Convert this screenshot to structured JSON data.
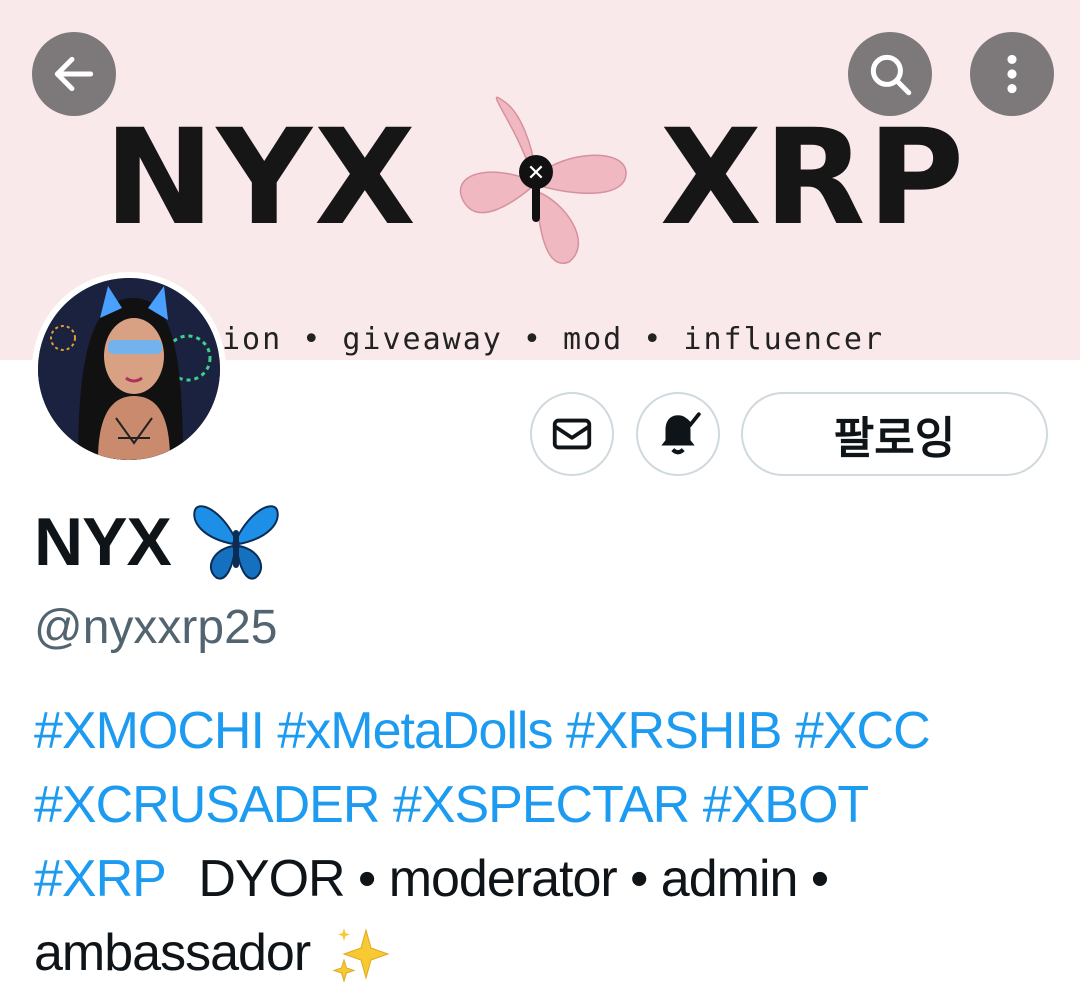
{
  "banner": {
    "word_left": "NYX",
    "word_right": "XRP",
    "tagline": "ion • giveaway • mod • influencer"
  },
  "nav": {
    "back_icon": "arrow-left-icon",
    "search_icon": "search-icon",
    "more_icon": "more-vertical-icon"
  },
  "actions": {
    "message_icon": "envelope-icon",
    "notify_icon": "bell-check-icon",
    "follow_label": "팔로잉"
  },
  "profile": {
    "display_name": "NYX",
    "name_emoji": "butterfly-icon",
    "handle": "@nyxxrp25"
  },
  "bio": {
    "line1": [
      "#XMOCHI",
      "#xMetaDolls",
      "#XRSHIB",
      "#XCC"
    ],
    "line2": [
      "#XCRUSADER",
      "#XSPECTAR",
      "#XBOT"
    ],
    "line3_tag": "#XRP",
    "line3_text": "DYOR • moderator • admin •",
    "line4_text": "ambassador",
    "end_emoji": "sparkles-icon"
  },
  "colors": {
    "banner_bg": "#f9e9ea",
    "hashtag": "#1d9bf0",
    "handle": "#536471",
    "text": "#0f1419",
    "button_border": "#cfd9de"
  }
}
